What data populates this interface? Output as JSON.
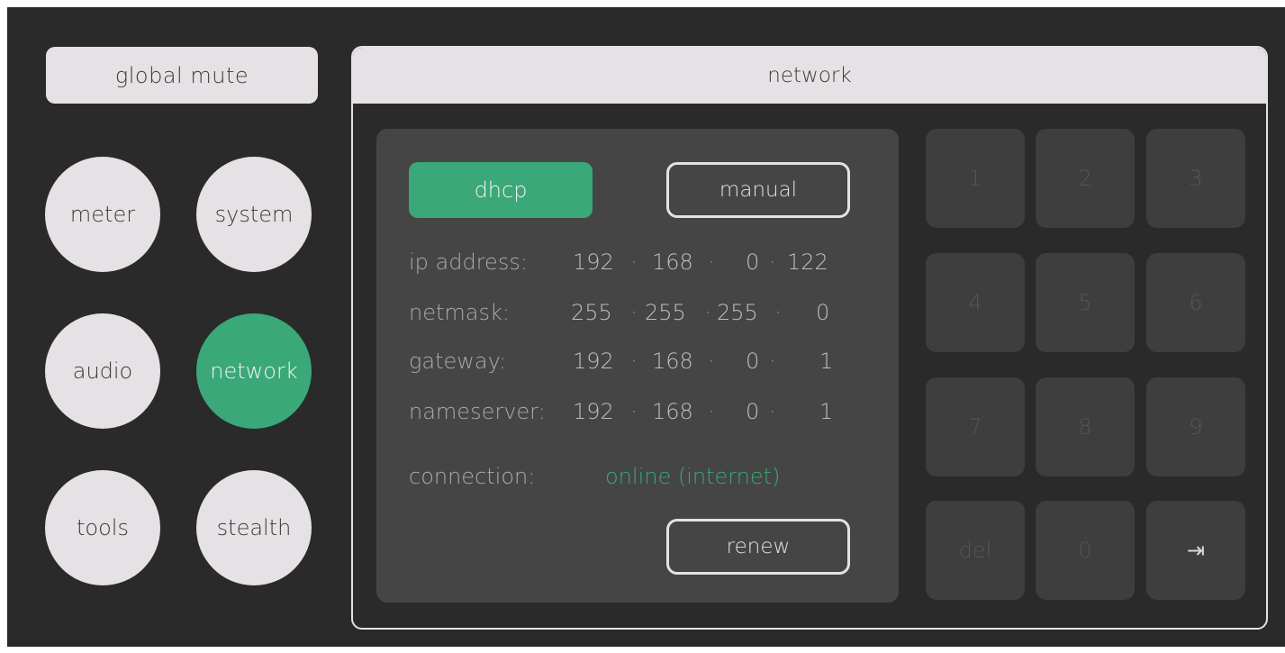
{
  "sidebar": {
    "global_mute": "global mute",
    "nav": {
      "meter": "meter",
      "system": "system",
      "audio": "audio",
      "network": "network",
      "tools": "tools",
      "stealth": "stealth"
    },
    "active": "network"
  },
  "panel": {
    "title": "network",
    "mode_dhcp": "dhcp",
    "mode_manual": "manual",
    "fields": {
      "ip": {
        "label": "ip address:",
        "octets": [
          "192",
          "168",
          "0",
          "122"
        ]
      },
      "netmask": {
        "label": "netmask:",
        "octets": [
          "255",
          "255",
          "255",
          "0"
        ]
      },
      "gateway": {
        "label": "gateway:",
        "octets": [
          "192",
          "168",
          "0",
          "1"
        ]
      },
      "nameserver": {
        "label": "nameserver:",
        "octets": [
          "192",
          "168",
          "0",
          "1"
        ]
      }
    },
    "dot": "·",
    "connection_label": "connection:",
    "connection_value": "online (internet)",
    "renew": "renew"
  },
  "keypad": {
    "k1": "1",
    "k2": "2",
    "k3": "3",
    "k4": "4",
    "k5": "5",
    "k6": "6",
    "k7": "7",
    "k8": "8",
    "k9": "9",
    "del": "del",
    "k0": "0",
    "tab": "⇥"
  },
  "colors": {
    "accent": "#3aa878",
    "background": "#2a2a2a",
    "light": "#e6e1e4"
  }
}
